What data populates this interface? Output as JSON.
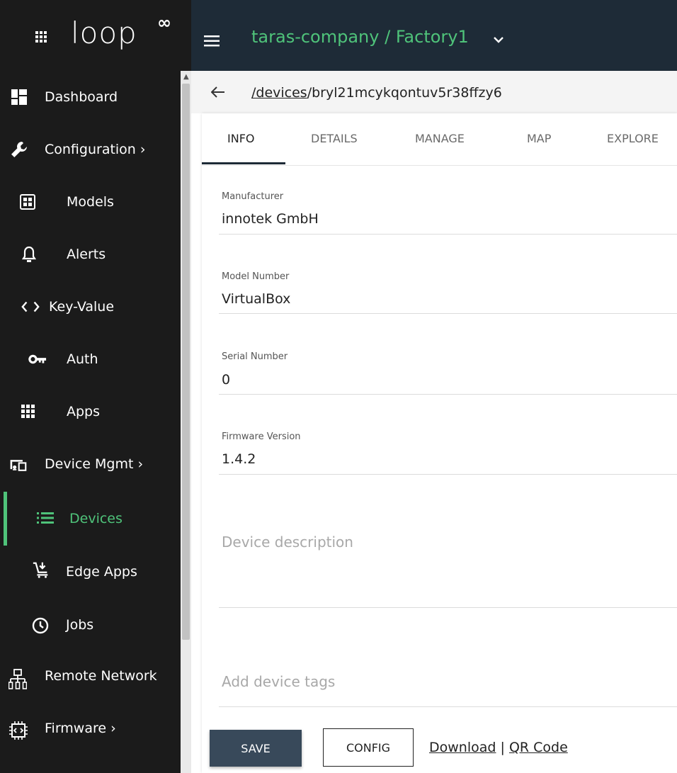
{
  "brand": {
    "logo_text": "loop",
    "logo_mark": "∞"
  },
  "header": {
    "org_title": "taras-company / Factory1"
  },
  "sidebar": {
    "items": [
      {
        "label": "Dashboard",
        "icon": "dashboard-icon"
      },
      {
        "label": "Configuration ›",
        "icon": "wrench-icon"
      },
      {
        "label": "Models",
        "icon": "models-icon"
      },
      {
        "label": "Alerts",
        "icon": "bell-icon"
      },
      {
        "label": "Key-Value",
        "icon": "code-icon"
      },
      {
        "label": "Auth",
        "icon": "key-icon"
      },
      {
        "label": "Apps",
        "icon": "apps-grid-icon"
      },
      {
        "label": "Device Mgmt ›",
        "icon": "device-mgmt-icon"
      },
      {
        "label": "Devices",
        "icon": "list-icon"
      },
      {
        "label": "Edge Apps",
        "icon": "cart-icon"
      },
      {
        "label": "Jobs",
        "icon": "clock-icon"
      },
      {
        "label": "Remote Network",
        "icon": "network-icon"
      },
      {
        "label": "Firmware ›",
        "icon": "chip-icon"
      }
    ],
    "active_label": "Devices",
    "accent": "#4fc37a"
  },
  "breadcrumb": {
    "link": "/devices",
    "rest": "/bryl21mcykqontuv5r38ffzy6"
  },
  "tabs": [
    "INFO",
    "DETAILS",
    "MANAGE",
    "MAP",
    "EXPLORE"
  ],
  "form": {
    "manufacturer_label": "Manufacturer",
    "manufacturer_value": "innotek GmbH",
    "model_label": "Model Number",
    "model_value": "VirtualBox",
    "serial_label": "Serial Number",
    "serial_value": "0",
    "firmware_label": "Firmware Version",
    "firmware_value": "1.4.2",
    "description_placeholder": "Device description",
    "tags_placeholder": "Add device tags"
  },
  "actions": {
    "save": "SAVE",
    "config": "CONFIG",
    "download": "Download",
    "separator": " | ",
    "qr": "QR Code"
  }
}
